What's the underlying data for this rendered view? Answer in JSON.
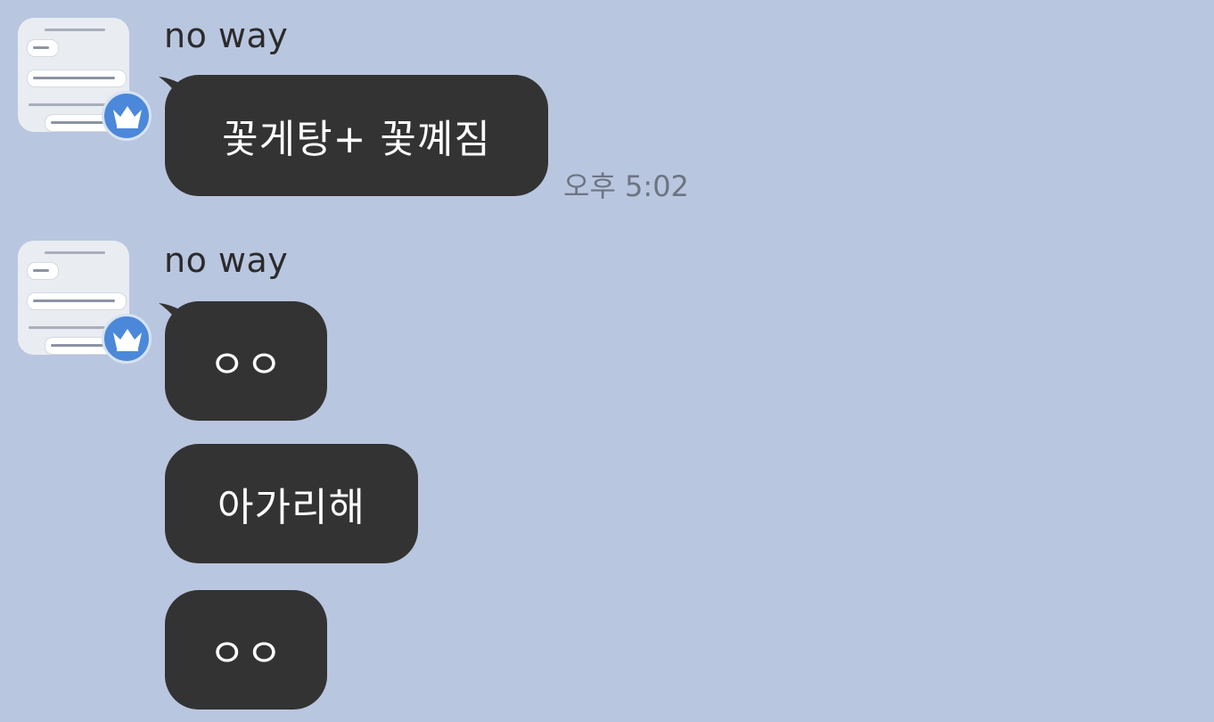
{
  "theme": {
    "background": "#b9c6df",
    "bubble_color": "#333333",
    "bubble_text_color": "#ffffff",
    "badge_color": "#4b88d9"
  },
  "messages": [
    {
      "sender": "no way",
      "bubbles": [
        {
          "text": "꽃게탕+ 꽃꼐짐",
          "time": "오후 5:02"
        }
      ]
    },
    {
      "sender": "no way",
      "bubbles": [
        {
          "text": "ㅇㅇ"
        },
        {
          "text": "아가리해"
        },
        {
          "text": "ㅇㅇ"
        }
      ]
    }
  ],
  "icons": {
    "avatar_badge": "crown-icon"
  }
}
